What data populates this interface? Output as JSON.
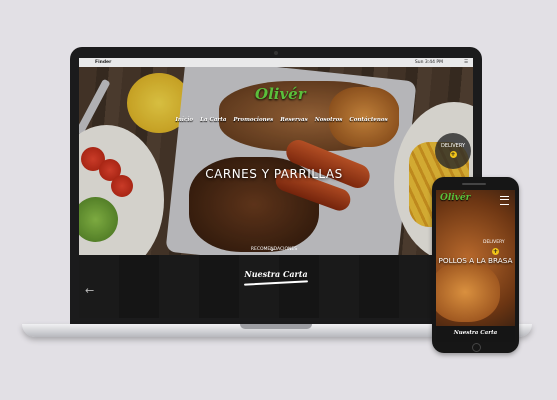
{
  "menubar": {
    "apple": "",
    "app": "Finder",
    "clock": "Sun 3:44 PM",
    "user": "☰"
  },
  "site": {
    "logo": "Olivér",
    "nav": [
      "Inicio",
      "La Carta",
      "Promociones",
      "Reservas",
      "Nosotros",
      "Contáctenos"
    ],
    "delivery_label": "DELIVERY",
    "delivery_icon": "+",
    "hero_title": "CARNES Y PARRILLAS",
    "recommend_label": "RECOMENDACIONES",
    "chevron": "⌄",
    "section_title": "Nuestra Carta",
    "back_arrow": "←"
  },
  "mobile": {
    "logo": "Olivér",
    "delivery_label": "DELIVERY",
    "delivery_icon": "+",
    "hero_title": "POLLOS A LA BRASA",
    "section_title": "Nuestra Carta"
  },
  "colors": {
    "accent": "#5bbf3b",
    "delivery_dot": "#f0c419",
    "background": "#e2e0e5"
  }
}
